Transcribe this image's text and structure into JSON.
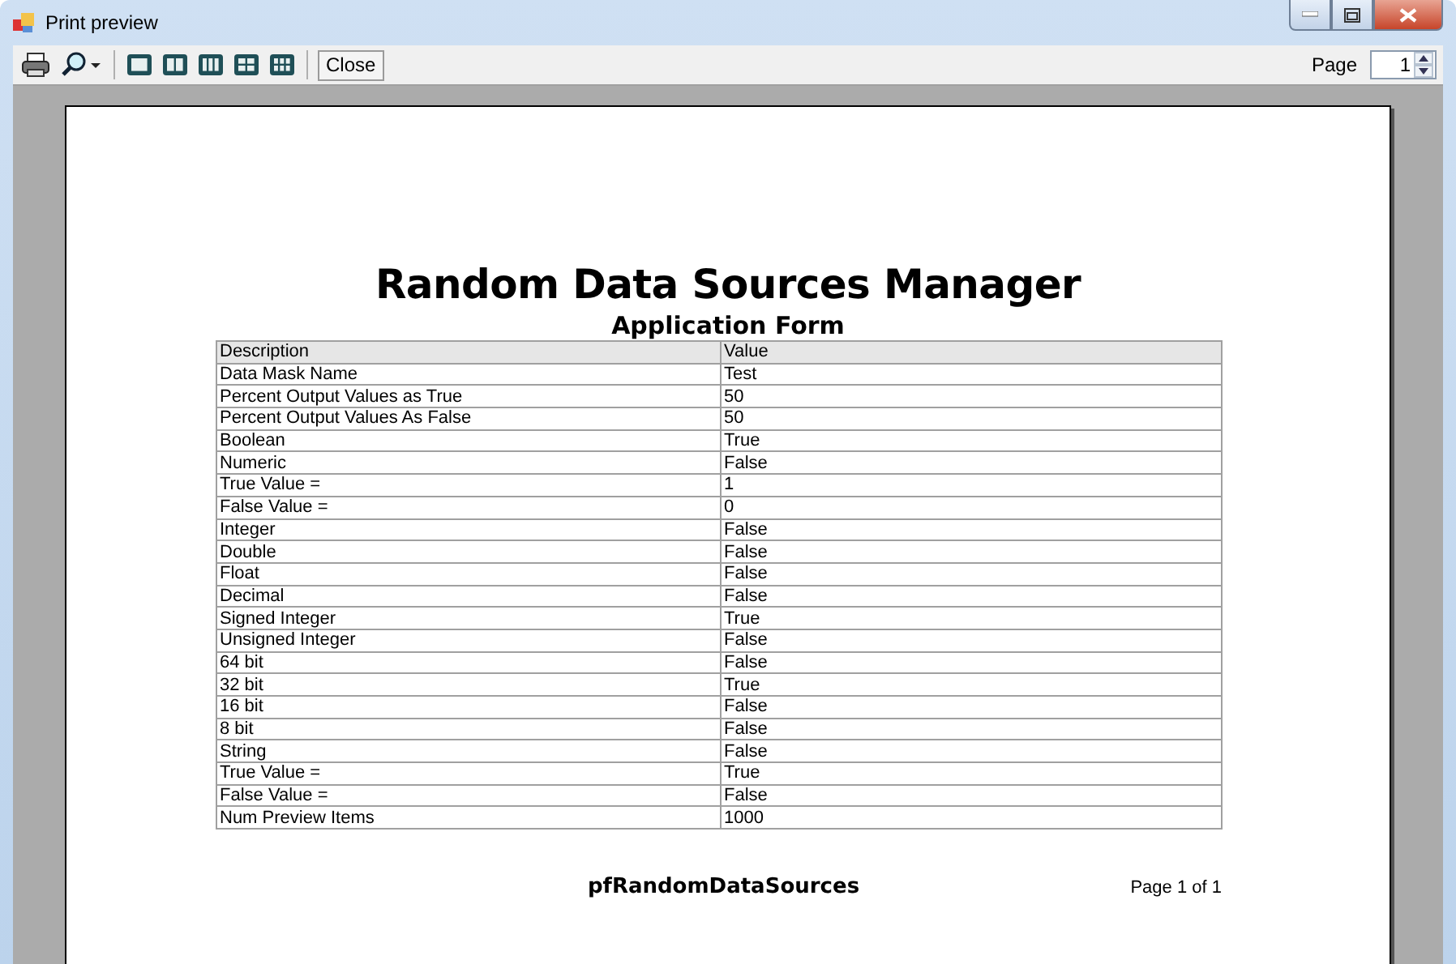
{
  "window": {
    "title": "Print preview"
  },
  "toolbar": {
    "close_label": "Close",
    "page_label": "Page",
    "page_value": "1"
  },
  "document": {
    "title": "Random Data Sources Manager",
    "subtitle": "Application Form",
    "columns": [
      "Description",
      "Value"
    ],
    "rows": [
      [
        "Data Mask Name",
        "Test"
      ],
      [
        "Percent Output Values as True",
        "50"
      ],
      [
        "Percent Output Values As False",
        "50"
      ],
      [
        "Boolean",
        "True"
      ],
      [
        "Numeric",
        "False"
      ],
      [
        "True Value =",
        "1"
      ],
      [
        "False Value =",
        "0"
      ],
      [
        "Integer",
        "False"
      ],
      [
        "Double",
        "False"
      ],
      [
        "Float",
        "False"
      ],
      [
        "Decimal",
        "False"
      ],
      [
        "Signed Integer",
        "True"
      ],
      [
        "Unsigned Integer",
        "False"
      ],
      [
        "64 bit",
        "False"
      ],
      [
        "32 bit",
        "True"
      ],
      [
        "16 bit",
        "False"
      ],
      [
        "8 bit",
        "False"
      ],
      [
        "String",
        "False"
      ],
      [
        "True Value =",
        "True"
      ],
      [
        "False Value =",
        "False"
      ],
      [
        "Num Preview Items",
        "1000"
      ]
    ],
    "footer_center": "pfRandomDataSources",
    "footer_right": "Page 1 of 1"
  }
}
